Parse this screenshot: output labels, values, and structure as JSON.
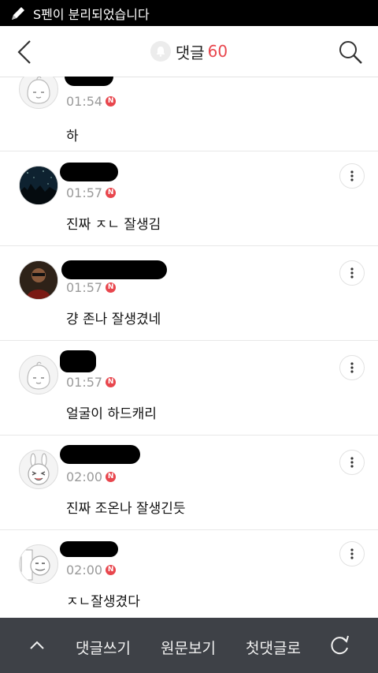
{
  "status_bar": {
    "text": "S펜이 분리되었습니다"
  },
  "header": {
    "title": "댓글",
    "count": "60"
  },
  "comments": [
    {
      "time": "01:54",
      "badge": "N",
      "text": "하"
    },
    {
      "time": "01:57",
      "badge": "N",
      "text": "진짜 ㅈㄴ 잘생김"
    },
    {
      "time": "01:57",
      "badge": "N",
      "text": "걍 존나 잘생겼네"
    },
    {
      "time": "01:57",
      "badge": "N",
      "text": "얼굴이 하드캐리"
    },
    {
      "time": "02:00",
      "badge": "N",
      "text": "진짜 조온나 잘생긴듯"
    },
    {
      "time": "02:00",
      "badge": "N",
      "text": "ㅈㄴ잘생겼다"
    }
  ],
  "bottom_bar": {
    "write": "댓글쓰기",
    "original": "원문보기",
    "first": "첫댓글로"
  },
  "colors": {
    "accent": "#e8464d",
    "bottom_bar_bg": "#3e4147",
    "status_bar_bg": "#000000"
  },
  "icons": [
    "pen-icon",
    "back-arrow-icon",
    "bell-icon",
    "search-icon",
    "more-options-icon",
    "chevron-up-icon",
    "refresh-icon"
  ]
}
